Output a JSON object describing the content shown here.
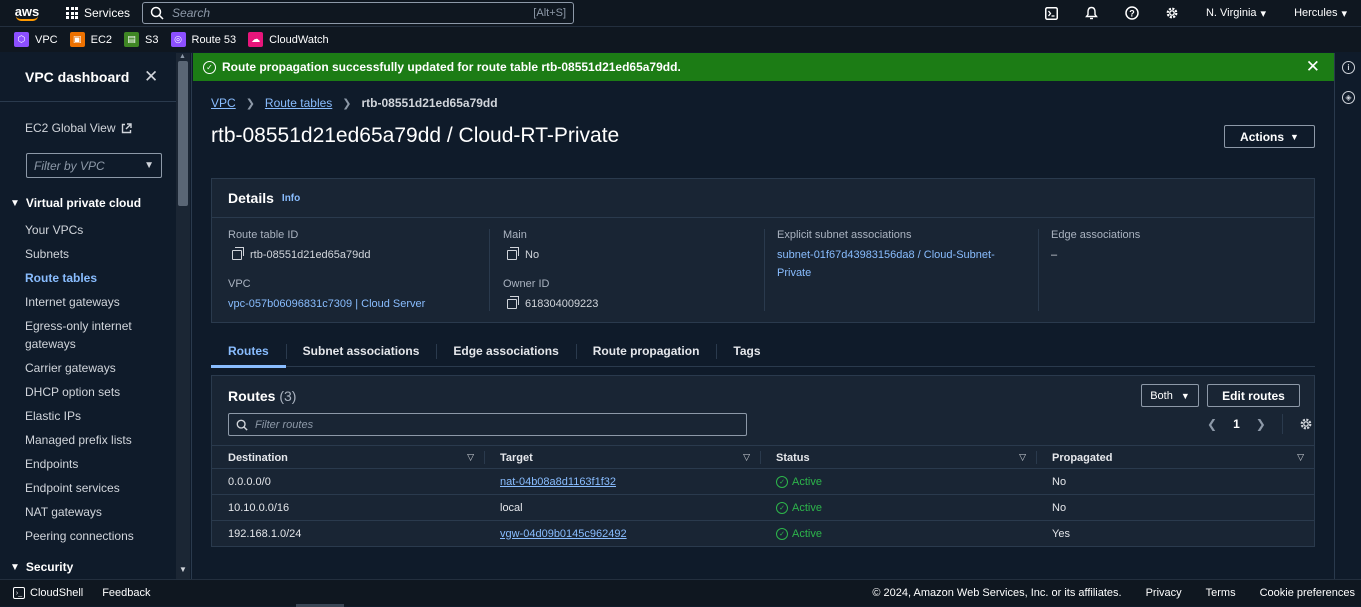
{
  "topnav": {
    "logo": "aws",
    "services_label": "Services",
    "search_placeholder": "Search",
    "search_shortcut": "[Alt+S]",
    "region": "N. Virginia",
    "user": "Hercules"
  },
  "favorites": [
    {
      "label": "VPC",
      "color": "#8c4fff"
    },
    {
      "label": "EC2",
      "color": "#ed7100"
    },
    {
      "label": "S3",
      "color": "#3f8624"
    },
    {
      "label": "Route 53",
      "color": "#8c4fff"
    },
    {
      "label": "CloudWatch",
      "color": "#e7157b"
    }
  ],
  "sidebar": {
    "title": "VPC dashboard",
    "ec2_global_view": "EC2 Global View",
    "filter_placeholder": "Filter by VPC",
    "section": "Virtual private cloud",
    "items": [
      "Your VPCs",
      "Subnets",
      "Route tables",
      "Internet gateways",
      "Egress-only internet gateways",
      "Carrier gateways",
      "DHCP option sets",
      "Elastic IPs",
      "Managed prefix lists",
      "Endpoints",
      "Endpoint services",
      "NAT gateways",
      "Peering connections"
    ],
    "active_item": "Route tables",
    "security_section": "Security"
  },
  "flash": {
    "message": "Route propagation successfully updated for route table rtb-08551d21ed65a79dd."
  },
  "breadcrumb": {
    "vpc": "VPC",
    "route_tables": "Route tables",
    "current": "rtb-08551d21ed65a79dd"
  },
  "page_title": "rtb-08551d21ed65a79dd / Cloud-RT-Private",
  "actions_label": "Actions",
  "details": {
    "title": "Details",
    "info": "Info",
    "route_table_id_label": "Route table ID",
    "route_table_id": "rtb-08551d21ed65a79dd",
    "vpc_label": "VPC",
    "vpc": "vpc-057b06096831c7309 | Cloud Server",
    "main_label": "Main",
    "main": "No",
    "owner_label": "Owner ID",
    "owner": "618304009223",
    "explicit_label": "Explicit subnet associations",
    "explicit_line1": "subnet-01f67d43983156da8 / Cloud-Subnet-",
    "explicit_line2": "Private",
    "edge_label": "Edge associations",
    "edge": "–"
  },
  "tabs": [
    "Routes",
    "Subnet associations",
    "Edge associations",
    "Route propagation",
    "Tags"
  ],
  "routes": {
    "title": "Routes",
    "count": "(3)",
    "both_label": "Both",
    "edit_label": "Edit routes",
    "filter_placeholder": "Filter routes",
    "page": "1",
    "columns": [
      "Destination",
      "Target",
      "Status",
      "Propagated"
    ],
    "rows": [
      {
        "destination": "0.0.0.0/0",
        "target": "nat-04b08a8d1163f1f32",
        "status": "Active",
        "propagated": "No"
      },
      {
        "destination": "10.10.0.0/16",
        "target": "local",
        "status": "Active",
        "propagated": "No"
      },
      {
        "destination": "192.168.1.0/24",
        "target": "vgw-04d09b0145c962492",
        "status": "Active",
        "propagated": "Yes"
      }
    ]
  },
  "footer": {
    "cloudshell": "CloudShell",
    "feedback": "Feedback",
    "copyright": "© 2024, Amazon Web Services, Inc. or its affiliates.",
    "privacy": "Privacy",
    "terms": "Terms",
    "cookies": "Cookie preferences"
  }
}
